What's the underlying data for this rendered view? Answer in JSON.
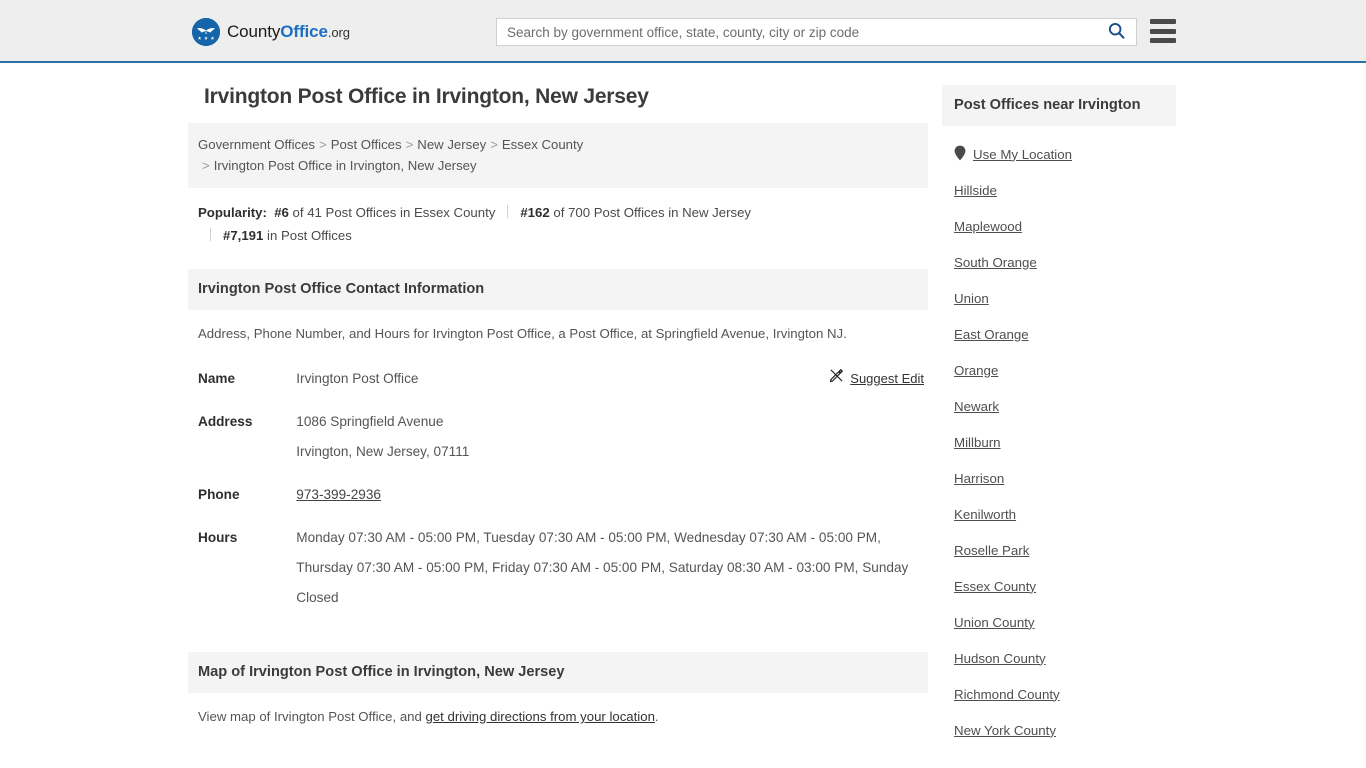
{
  "header": {
    "brand": {
      "part1": "County",
      "part2": "Office",
      "part3": ".org",
      "logo_icon": "eagle-seal-logo"
    },
    "search": {
      "placeholder": "Search by government office, state, county, city or zip code",
      "value": "",
      "search_icon": "search-icon"
    },
    "menu_icon": "hamburger-menu-icon",
    "accent_color": "#2f6ea5",
    "background_color": "#eeeeee"
  },
  "page": {
    "title": "Irvington Post Office in Irvington, New Jersey"
  },
  "breadcrumb": {
    "separator": ">",
    "items": [
      "Government Offices",
      "Post Offices",
      "New Jersey",
      "Essex County"
    ],
    "current": "Irvington Post Office in Irvington, New Jersey"
  },
  "popularity": {
    "label": "Popularity:",
    "items": [
      {
        "rank": "#6",
        "text": "of 41 Post Offices in Essex County"
      },
      {
        "rank": "#162",
        "text": "of 700 Post Offices in New Jersey"
      },
      {
        "rank": "#7,191",
        "text": "in Post Offices"
      }
    ]
  },
  "contact": {
    "section_title": "Irvington Post Office Contact Information",
    "description": "Address, Phone Number, and Hours for Irvington Post Office, a Post Office, at Springfield Avenue, Irvington NJ.",
    "suggest_edit": {
      "label": "Suggest Edit",
      "icon": "edit-pencil-icon"
    },
    "rows": {
      "name_label": "Name",
      "name_value": "Irvington Post Office",
      "address_label": "Address",
      "address_line1": "1086 Springfield Avenue",
      "address_line2": "Irvington, New Jersey, 07111",
      "phone_label": "Phone",
      "phone_value": "973-399-2936",
      "hours_label": "Hours",
      "hours_value": "Monday 07:30 AM - 05:00 PM, Tuesday 07:30 AM - 05:00 PM, Wednesday 07:30 AM - 05:00 PM, Thursday 07:30 AM - 05:00 PM, Friday 07:30 AM - 05:00 PM, Saturday 08:30 AM - 03:00 PM, Sunday Closed"
    }
  },
  "map": {
    "section_title": "Map of Irvington Post Office in Irvington, New Jersey",
    "desc_prefix": "View map of Irvington Post Office, and ",
    "desc_link": "get driving directions from your location",
    "desc_suffix": "."
  },
  "sidebar": {
    "title": "Post Offices near Irvington",
    "use_my_location": {
      "label": "Use My Location",
      "icon": "map-pin-icon"
    },
    "items": [
      {
        "label": "Hillside"
      },
      {
        "label": "Maplewood"
      },
      {
        "label": "South Orange"
      },
      {
        "label": "Union"
      },
      {
        "label": "East Orange"
      },
      {
        "label": "Orange"
      },
      {
        "label": "Newark"
      },
      {
        "label": "Millburn"
      },
      {
        "label": "Harrison"
      },
      {
        "label": "Kenilworth"
      },
      {
        "label": "Roselle Park"
      },
      {
        "label": "Essex County"
      },
      {
        "label": "Union County"
      },
      {
        "label": "Hudson County"
      },
      {
        "label": "Richmond County"
      },
      {
        "label": "New York County"
      }
    ]
  }
}
